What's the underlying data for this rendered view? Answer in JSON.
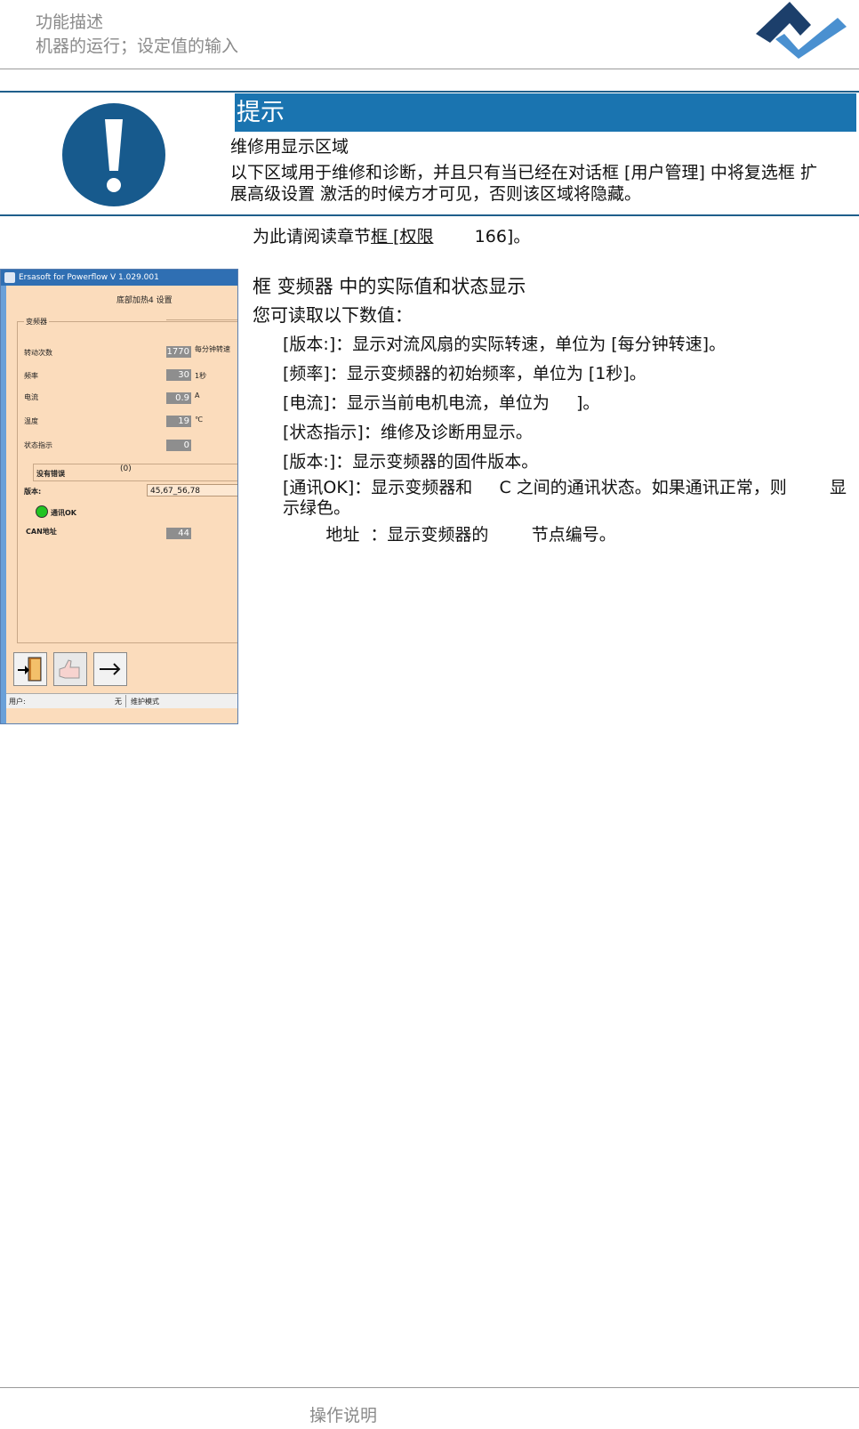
{
  "header": {
    "line1": "功能描述",
    "line2": "机器的运行；设定值的输入"
  },
  "notice": {
    "heading": "提示",
    "subtitle": "维修用显示区域",
    "body_line1": "以下区域用于维修和诊断，并且只有当已经在对话框 [用户管理] 中将复选框  扩",
    "body_line2": "展高级设置  激活的时候方才可见，否则该区域将隐藏。"
  },
  "reference": {
    "text_before": "为此请阅读章节",
    "link": "框 [权限",
    "text_after": "     166]。"
  },
  "section": {
    "title": "框  变频器  中的实际值和状态显示",
    "intro": "您可读取以下数值："
  },
  "items": [
    "[版本:]：显示对流风扇的实际转速，单位为 [每分钟转速]。",
    "[频率]：显示变频器的初始频率，单位为 [1秒]。",
    "[电流]：显示当前电机电流，单位为     ]。",
    "[状态指示]：维修及诊断用显示。",
    "[版本:]：显示变频器的固件版本。",
    "[通讯OK]：显示变频器和     C 之间的通讯状态。如果通讯正常，则        显",
    "示绿色。",
    "        地址  ：显示变频器的        节点编号。"
  ],
  "screenshot": {
    "window_title": "Ersasoft for Powerflow V 1.029.001",
    "panel_title": "底部加热4 设置",
    "group_label": "变频器",
    "rows": [
      {
        "label": "转动次数",
        "value": "1770",
        "unit": "每分钟转速"
      },
      {
        "label": "频率",
        "value": "30",
        "unit": "1秒"
      },
      {
        "label": "电流",
        "value": "0.9",
        "unit": "A"
      },
      {
        "label": "温度",
        "value": "19",
        "unit": "℃"
      },
      {
        "label": "状态指示",
        "value": "0",
        "unit": ""
      }
    ],
    "status_text": "没有错误",
    "status_code": "(0)",
    "version_label": "版本:",
    "version_value": "45,67_56,78",
    "comm_label": "通讯OK",
    "can_label": "CAN地址",
    "can_value": "44",
    "statusbar_user": "用户:",
    "statusbar_none": "无",
    "statusbar_mode": "维护模式",
    "colors": {
      "panel": "#fbdcbc",
      "titlebar": "#2f6fb3",
      "led": "#22c422"
    }
  },
  "footer": {
    "text": "操作说明"
  },
  "colors": {
    "accent": "#1a74b0",
    "icon_circle": "#175a8d",
    "logo_dark": "#1c3f6b",
    "logo_light": "#4a90d0"
  }
}
